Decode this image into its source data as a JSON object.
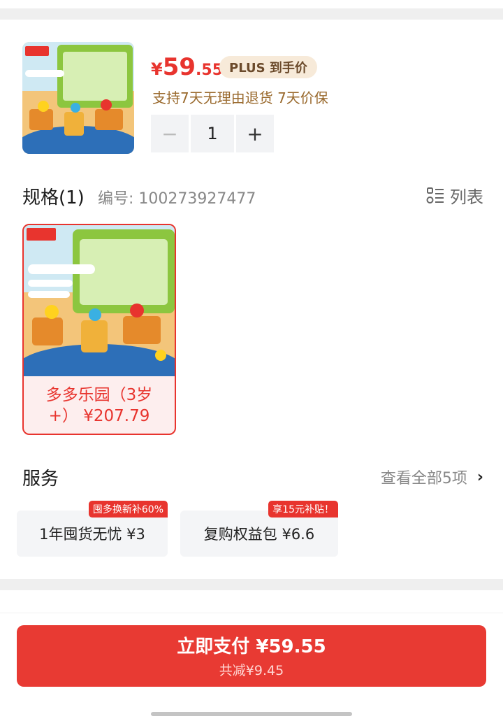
{
  "product": {
    "currency": "¥",
    "price_int": "59",
    "price_dec": ".55",
    "plus_badge": "PLUS 到手价",
    "return_policy": "支持7天无理由退货  7天价保",
    "quantity": "1",
    "minus_symbol": "−",
    "plus_symbol": "+",
    "thumb_icon": "toy-bucket-product-image"
  },
  "spec": {
    "title": "规格(1)",
    "code": "编号: 100273927477",
    "list_label": "列表",
    "list_icon": "list-view-icon",
    "items": [
      {
        "label": "多多乐园（3岁+） ¥207.79",
        "selected": true
      }
    ]
  },
  "service": {
    "title": "服务",
    "view_all": "查看全部5项",
    "chevron": "›",
    "items": [
      {
        "label": "1年囤货无忧  ¥3",
        "tag": "囤多换新补60%"
      },
      {
        "label": "复购权益包  ¥6.6",
        "tag": "享15元补贴！"
      }
    ]
  },
  "pay": {
    "main": "立即支付 ¥59.55",
    "sub": "共减¥9.45"
  },
  "colors": {
    "accent": "#e8342e",
    "plus_badge_bg": "#f7ead9",
    "gold_text": "#9a6a2e"
  }
}
